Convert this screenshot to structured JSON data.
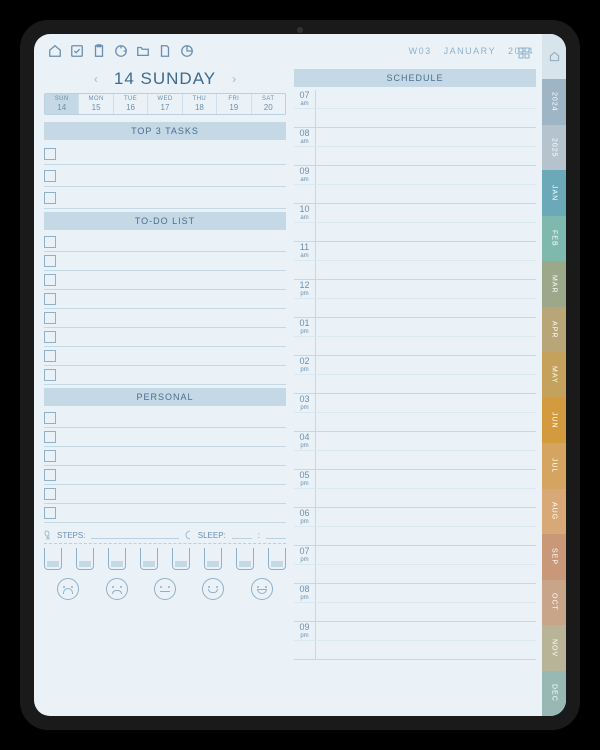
{
  "date": {
    "day_num": "14",
    "day_name": "SUNDAY"
  },
  "week_strip": [
    {
      "name": "SUN",
      "num": "14",
      "active": true
    },
    {
      "name": "MON",
      "num": "15"
    },
    {
      "name": "TUE",
      "num": "16"
    },
    {
      "name": "WED",
      "num": "17"
    },
    {
      "name": "THU",
      "num": "18"
    },
    {
      "name": "FRI",
      "num": "19"
    },
    {
      "name": "SAT",
      "num": "20"
    }
  ],
  "sections": {
    "top3": "TOP 3 TASKS",
    "todo": "TO-DO LIST",
    "personal": "PERSONAL",
    "schedule": "SCHEDULE"
  },
  "trackers": {
    "steps": "STEPS:",
    "sleep": "SLEEP:"
  },
  "right_header": {
    "week": "W03",
    "month": "JANUARY",
    "year": "2024"
  },
  "schedule_hours": [
    {
      "h": "07",
      "ap": "am"
    },
    {
      "h": "08",
      "ap": "am"
    },
    {
      "h": "09",
      "ap": "am"
    },
    {
      "h": "10",
      "ap": "am"
    },
    {
      "h": "11",
      "ap": "am"
    },
    {
      "h": "12",
      "ap": "pm"
    },
    {
      "h": "01",
      "ap": "pm"
    },
    {
      "h": "02",
      "ap": "pm"
    },
    {
      "h": "03",
      "ap": "pm"
    },
    {
      "h": "04",
      "ap": "pm"
    },
    {
      "h": "05",
      "ap": "pm"
    },
    {
      "h": "06",
      "ap": "pm"
    },
    {
      "h": "07",
      "ap": "pm"
    },
    {
      "h": "08",
      "ap": "pm"
    },
    {
      "h": "09",
      "ap": "pm"
    }
  ],
  "tabs": [
    {
      "label": "2024",
      "color": "#9db5c5"
    },
    {
      "label": "2025",
      "color": "#b5c3ce"
    },
    {
      "label": "JAN",
      "color": "#6ba8b8"
    },
    {
      "label": "FEB",
      "color": "#7fb8ac"
    },
    {
      "label": "MAR",
      "color": "#9ca88a"
    },
    {
      "label": "APR",
      "color": "#b8a678"
    },
    {
      "label": "MAY",
      "color": "#c4a25c"
    },
    {
      "label": "JUN",
      "color": "#d49a3e"
    },
    {
      "label": "JUL",
      "color": "#d4a460"
    },
    {
      "label": "AUG",
      "color": "#d8a876"
    },
    {
      "label": "SEP",
      "color": "#c89878"
    },
    {
      "label": "OCT",
      "color": "#c8a488"
    },
    {
      "label": "NOV",
      "color": "#b8b498"
    },
    {
      "label": "DEC",
      "color": "#98b8b4"
    }
  ],
  "counts": {
    "top3": 3,
    "todo": 8,
    "personal": 6,
    "water": 8,
    "moods": 5
  }
}
